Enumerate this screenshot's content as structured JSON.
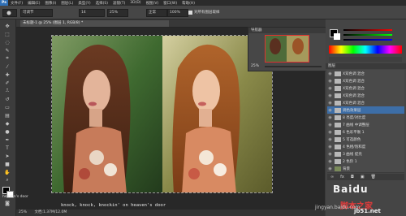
{
  "menu": {
    "logo": "Ps",
    "items": [
      "文件(F)",
      "编辑(E)",
      "图像(I)",
      "图层(L)",
      "类型(Y)",
      "选择(S)",
      "滤镜(T)",
      "3D(D)",
      "视图(V)",
      "窗口(W)",
      "帮助(H)"
    ]
  },
  "options": {
    "preset_value": "可调节",
    "size_value": "14",
    "opacity_value": "25%",
    "flow_value": "正常",
    "flow2_value": "100%",
    "checkbox_label": "清除或者取",
    "checkbox2_label": "对所有图层取样"
  },
  "document": {
    "tab_title": "未标题-1 @ 25% (图层 1, RGB/8) *"
  },
  "navigator": {
    "title": "导航器",
    "zoom": "25%"
  },
  "color_panel": {
    "swatches": [
      "#ff0000",
      "#ff8000",
      "#ffff00",
      "#00ff00",
      "#00ffff",
      "#0000ff",
      "#ff00ff",
      "#ffffff",
      "#000000"
    ]
  },
  "layers": {
    "title": "图层",
    "rows": [
      {
        "label": "X双色调 混合",
        "active": false
      },
      {
        "label": "X双色调 混合",
        "active": false
      },
      {
        "label": "X双色调 混合",
        "active": false
      },
      {
        "label": "X双色调 混合",
        "active": false
      },
      {
        "label": "X双色调 混合",
        "active": false
      },
      {
        "label": "调色效果层",
        "active": true
      },
      {
        "label": "8 亮度/对比度",
        "active": false
      },
      {
        "label": "7 曲线 中调整层",
        "active": false
      },
      {
        "label": "6 色彩平衡 1",
        "active": false
      },
      {
        "label": "5 可选颜色",
        "active": false
      },
      {
        "label": "4 色相/饱和度",
        "active": false
      },
      {
        "label": "3 曲线 提亮",
        "active": false
      },
      {
        "label": "2 色阶 1",
        "active": false
      },
      {
        "label": "背景",
        "active": false
      }
    ],
    "bottom_label": "fx"
  },
  "status": {
    "zoom": "25%",
    "doc_info": "文档:1.37M/12.0M"
  },
  "overlay": {
    "lyrics": "knock, knock, knockin' on heaven's door",
    "side_lyric": "heaven's door",
    "watermark": "Baidu",
    "watermark_cn": "脚本之家",
    "site": "jingyan.baidu.com",
    "jb": "jb51.net"
  }
}
